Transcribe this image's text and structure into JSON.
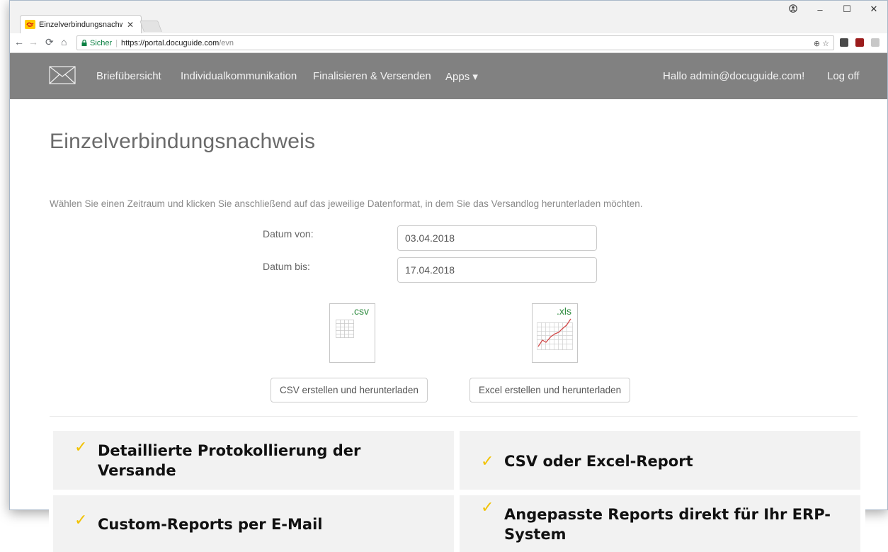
{
  "browser": {
    "tab_title": "Einzelverbindungsnachw",
    "secure_label": "Sicher",
    "url_host": "https://portal.docuguide.com",
    "url_path": "/evn"
  },
  "navbar": {
    "links": [
      "Briefübersicht",
      "Individualkommunikation",
      "Finalisieren & Versenden",
      "Apps ▾"
    ],
    "greeting": "Hallo admin@docuguide.com!",
    "logoff": "Log off"
  },
  "page": {
    "title": "Einzelverbindungsnachweis",
    "instruction": "Wählen Sie einen Zeitraum und klicken Sie anschließend auf das jeweilige Datenformat, in dem Sie das Versandlog herunterladen möchten.",
    "date_from_label": "Datum von:",
    "date_from_value": "03.04.2018",
    "date_to_label": "Datum bis:",
    "date_to_value": "17.04.2018",
    "csv_ext": ".csv",
    "xls_ext": ".xls",
    "csv_button": "CSV erstellen und herunterladen",
    "excel_button": "Excel erstellen und herunterladen"
  },
  "features": [
    {
      "text": "Detaillierte Protokollierung der Versande"
    },
    {
      "text": "CSV oder Excel-Report"
    },
    {
      "text": "Custom-Reports per E-Mail"
    },
    {
      "text": "Angepasste Reports direkt für Ihr ERP-System"
    }
  ],
  "colors": {
    "navbar": "#818181",
    "check": "#f2c200",
    "feature_bg": "#f2f2f2"
  }
}
